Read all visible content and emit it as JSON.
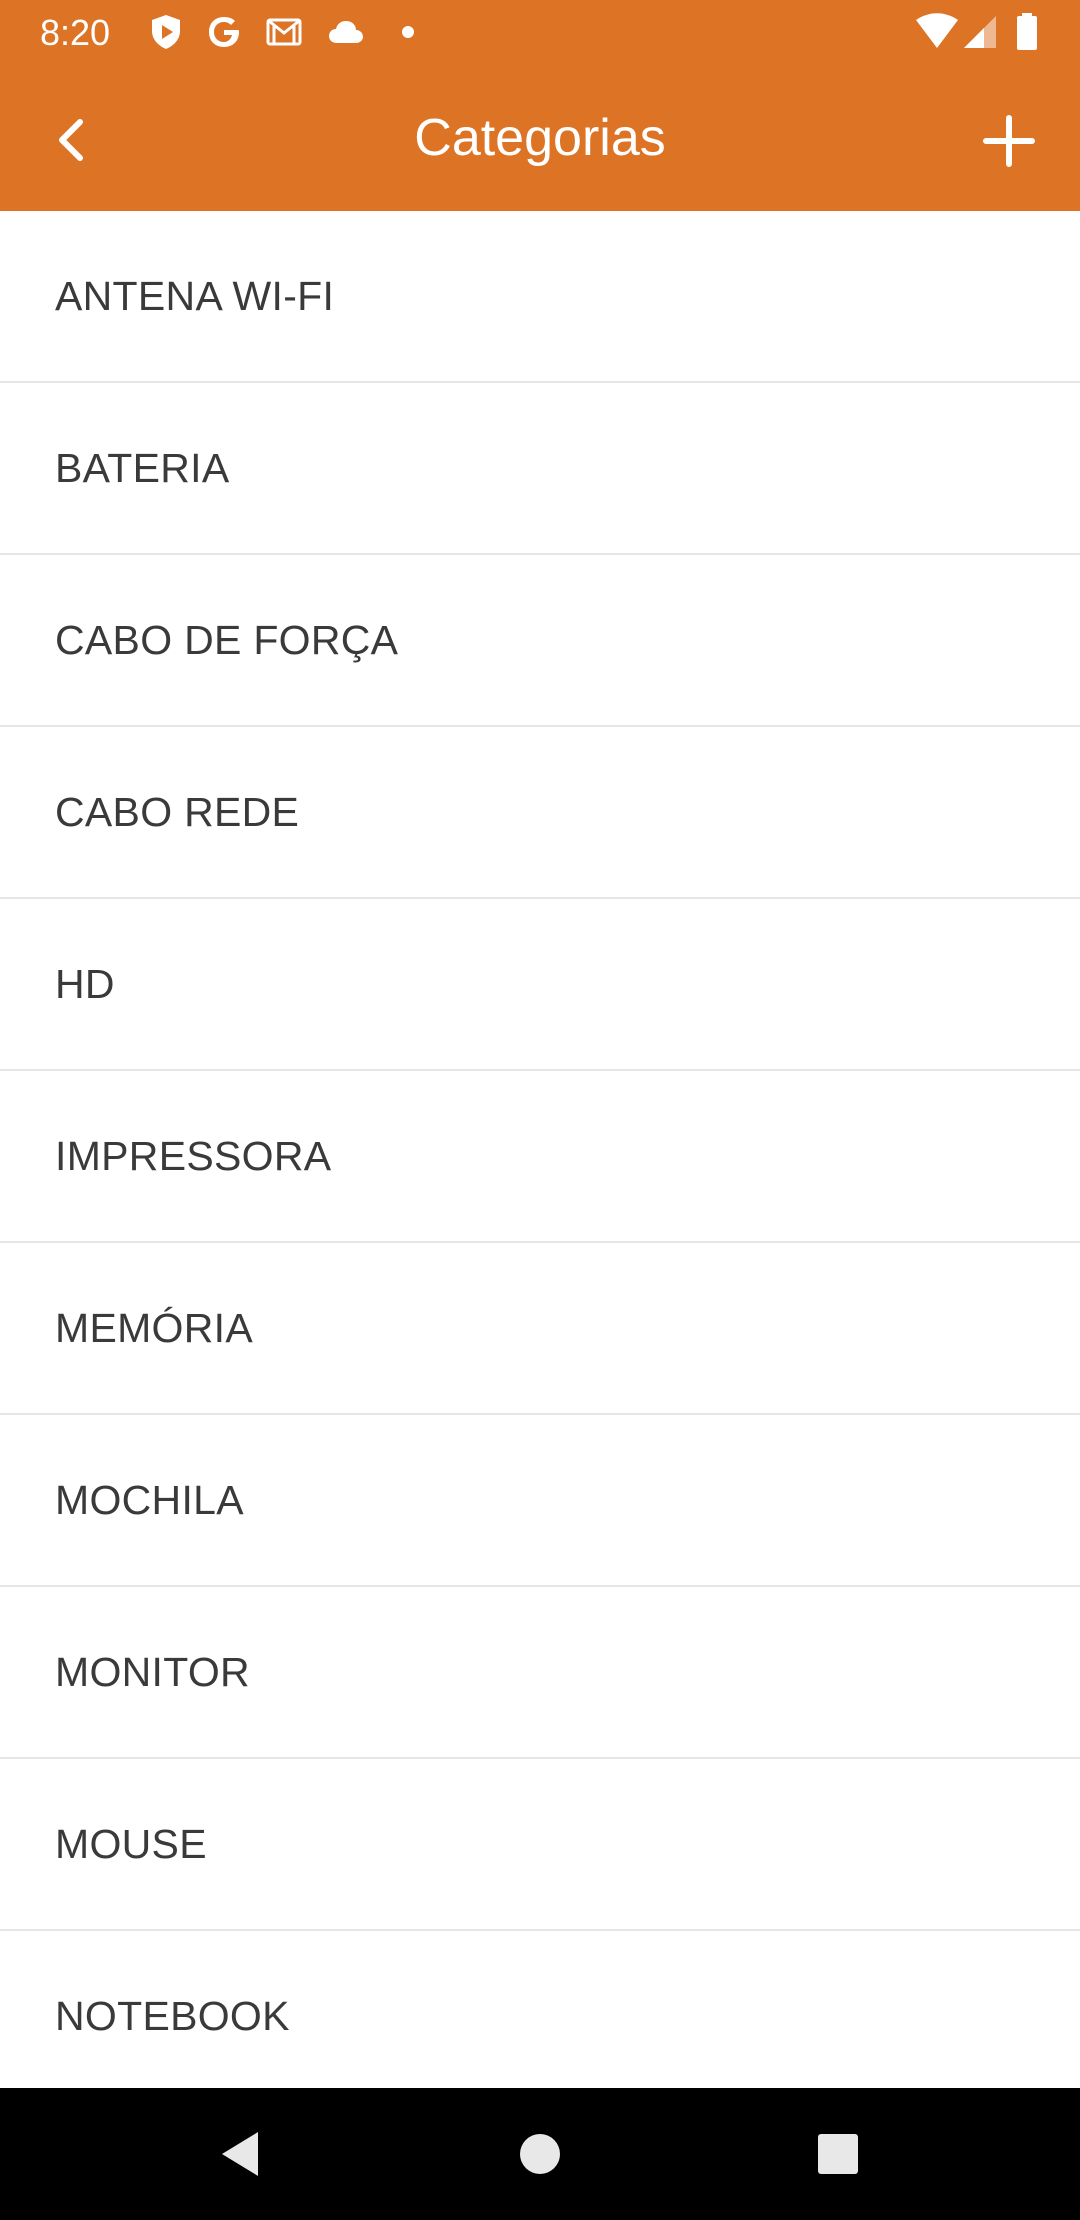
{
  "status_bar": {
    "time": "8:20",
    "icons": [
      "shield-play-icon",
      "google-icon",
      "gmail-icon",
      "cloud-icon",
      "dot-icon",
      "wifi-icon",
      "signal-icon",
      "battery-icon"
    ]
  },
  "app_bar": {
    "title": "Categorias",
    "back_icon": "chevron-left-icon",
    "add_icon": "plus-icon"
  },
  "categories": [
    {
      "label": "ANTENA WI-FI"
    },
    {
      "label": "BATERIA"
    },
    {
      "label": "CABO DE FORÇA"
    },
    {
      "label": "CABO REDE"
    },
    {
      "label": "HD"
    },
    {
      "label": "IMPRESSORA"
    },
    {
      "label": "MEMÓRIA"
    },
    {
      "label": "MOCHILA"
    },
    {
      "label": "MONITOR"
    },
    {
      "label": "MOUSE"
    },
    {
      "label": "NOTEBOOK"
    }
  ],
  "nav_bar": {
    "icons": [
      "back-triangle-icon",
      "home-circle-icon",
      "recents-square-icon"
    ]
  },
  "colors": {
    "accent": "#DD7324",
    "list_text": "#3A3A3A",
    "divider": "#E6E6E6",
    "nav_background": "#000000"
  }
}
